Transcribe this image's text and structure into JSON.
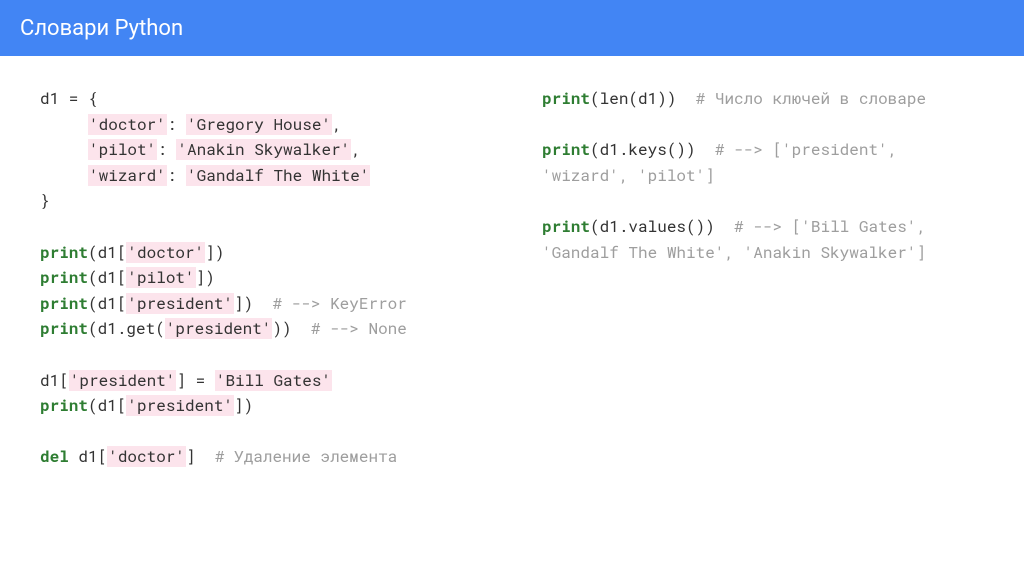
{
  "header": {
    "title": "Словари Python"
  },
  "code": {
    "d1_decl": "d1 = {",
    "k_doctor": "'doctor'",
    "v_doctor": "'Gregory House'",
    "k_pilot": "'pilot'",
    "v_pilot": "'Anakin Skywalker'",
    "k_wizard": "'wizard'",
    "v_wizard": "'Gandalf The White'",
    "brace_close": "}",
    "print": "print",
    "del": "del",
    "lparen_d1_lbr": "(d1[",
    "rbr_rparen": "])",
    "s_doctor": "'doctor'",
    "s_pilot": "'pilot'",
    "s_president": "'president'",
    "cmt_keyerror": "  # --> KeyError",
    "get_open": "(d1.get(",
    "get_close": "))",
    "cmt_none": "  # --> None",
    "assign_pre": "d1[",
    "assign_mid": "] = ",
    "v_bill": "'Bill Gates'",
    "del_pre": " d1[",
    "del_close": "]",
    "cmt_del": "  # Удаление элемента",
    "len_open": "(len(d1))",
    "cmt_len": "  # Число ключей в словаре",
    "keys_call": "(d1.keys())",
    "cmt_keys": "  # --> ['president', 'wizard', 'pilot']",
    "values_call": "(d1.values())",
    "cmt_values": "  # --> ['Bill Gates', 'Gandalf The White', 'Anakin Skywalker']"
  }
}
